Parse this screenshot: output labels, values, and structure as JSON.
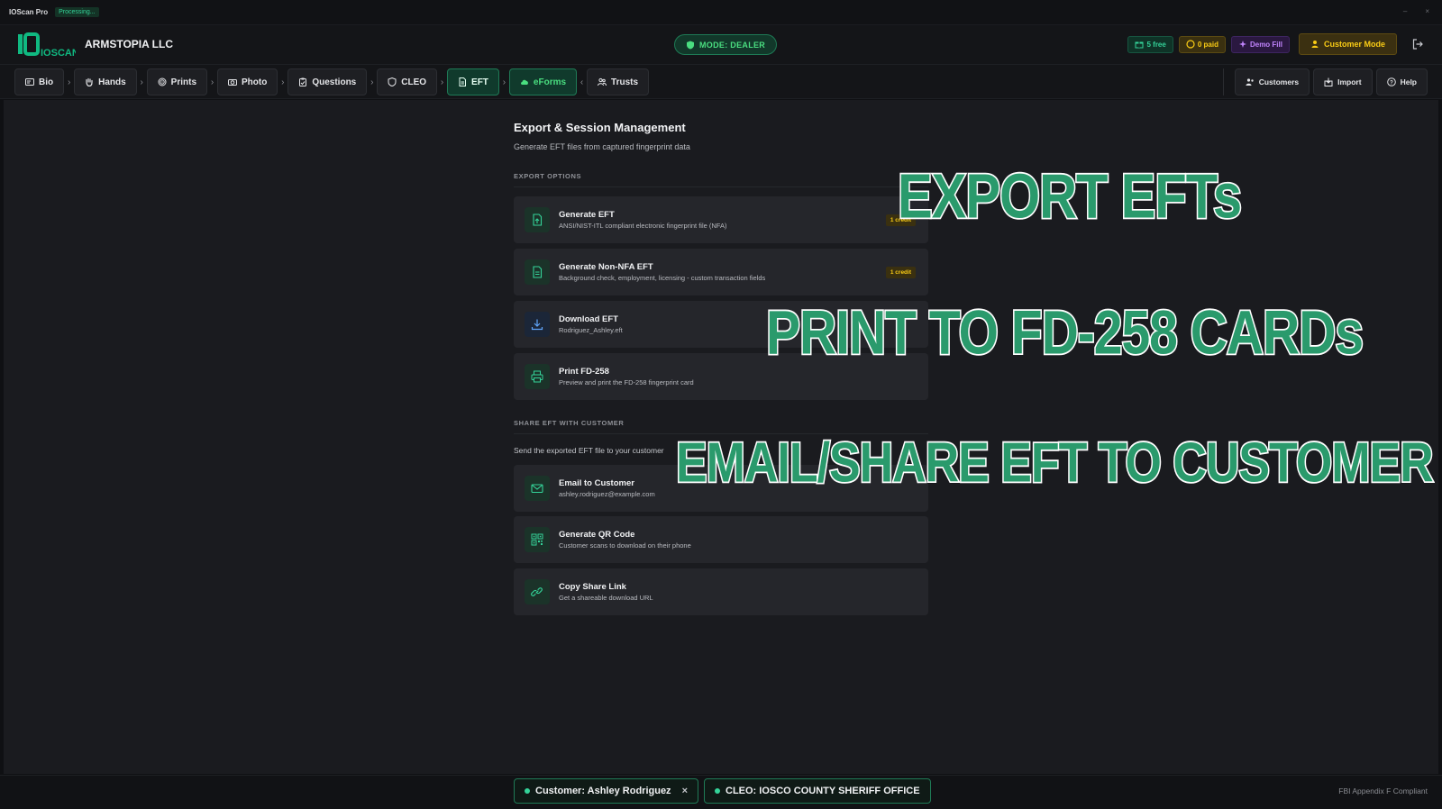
{
  "titlebar": {
    "app_name": "IOScan Pro",
    "status": "Processing..."
  },
  "header": {
    "logo_text": "IOSCAN",
    "company": "ARMSTOPIA LLC",
    "mode": "MODE: DEALER",
    "free": "5 free",
    "paid": "0 paid",
    "demo": "Demo Fill",
    "customer_mode": "Customer Mode"
  },
  "nav": {
    "steps": [
      {
        "label": "Bio",
        "icon": "id-card-icon"
      },
      {
        "label": "Hands",
        "icon": "hand-icon"
      },
      {
        "label": "Prints",
        "icon": "fingerprint-icon"
      },
      {
        "label": "Photo",
        "icon": "camera-icon"
      },
      {
        "label": "Questions",
        "icon": "clipboard-icon"
      },
      {
        "label": "CLEO",
        "icon": "shield-icon"
      },
      {
        "label": "EFT",
        "icon": "file-icon"
      },
      {
        "label": "eForms",
        "icon": "cloud-icon"
      },
      {
        "label": "Trusts",
        "icon": "users-icon"
      }
    ],
    "right": {
      "customers": "Customers",
      "import": "Import",
      "help": "Help"
    }
  },
  "main": {
    "title": "Export & Session Management",
    "subtitle": "Generate EFT files from captured fingerprint data",
    "export_label": "EXPORT OPTIONS",
    "export_options": [
      {
        "title": "Generate EFT",
        "desc": "ANSI/NIST-ITL compliant electronic fingerprint file (NFA)",
        "badge": "1 credit",
        "icon": "file-upload-icon"
      },
      {
        "title": "Generate Non-NFA EFT",
        "desc": "Background check, employment, licensing - custom transaction fields",
        "badge": "1 credit",
        "icon": "document-icon"
      },
      {
        "title": "Download EFT",
        "desc": "Rodriguez_Ashley.eft",
        "icon": "download-icon"
      },
      {
        "title": "Print FD-258",
        "desc": "Preview and print the FD-258 fingerprint card",
        "icon": "printer-icon"
      }
    ],
    "share_label": "SHARE EFT WITH CUSTOMER",
    "share_text": "Send the exported EFT file to your customer",
    "share_options": [
      {
        "title": "Email to Customer",
        "desc": "ashley.rodriguez@example.com",
        "icon": "mail-icon"
      },
      {
        "title": "Generate QR Code",
        "desc": "Customer scans to download on their phone",
        "icon": "qr-code-icon"
      },
      {
        "title": "Copy Share Link",
        "desc": "Get a shareable download URL",
        "icon": "link-icon"
      }
    ]
  },
  "overlays": {
    "line1": "EXPORT EFTs",
    "line2": "PRINT TO FD-258 CARDs",
    "line3": "EMAIL/SHARE EFT TO CUSTOMER"
  },
  "footer": {
    "customer": "Customer: Ashley Rodriguez",
    "cleo": "CLEO: IOSCO COUNTY SHERIFF OFFICE",
    "compliance": "FBI Appendix F Compliant"
  },
  "colors": {
    "accent": "#34d399",
    "gold": "#facc15",
    "purple": "#c084fc",
    "overlay_fill": "#2a9a6c"
  }
}
